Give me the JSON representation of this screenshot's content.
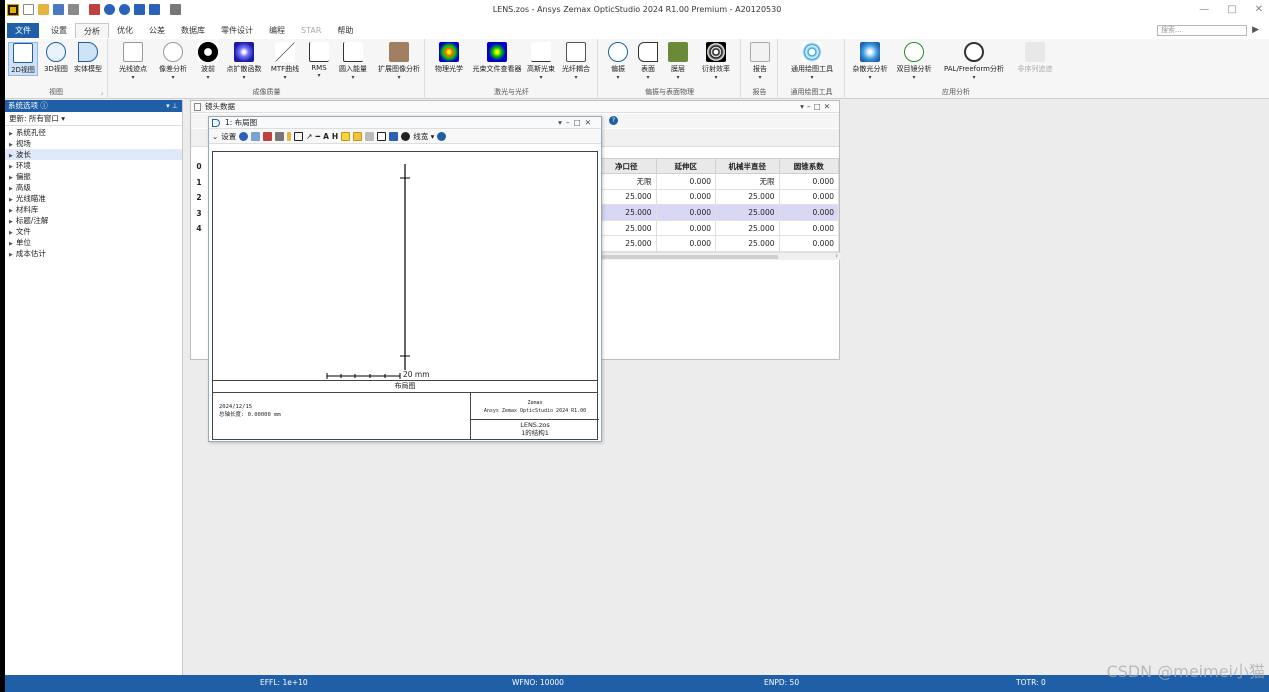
{
  "window": {
    "title": "LENS.zos - Ansys Zemax OpticStudio 2024 R1.00   Premium - A20120530",
    "controls": [
      "—",
      "□",
      "✕"
    ]
  },
  "ribbon_tabs": [
    {
      "label": "文件"
    },
    {
      "label": "设置"
    },
    {
      "label": "分析"
    },
    {
      "label": "优化"
    },
    {
      "label": "公差"
    },
    {
      "label": "数据库"
    },
    {
      "label": "零件设计"
    },
    {
      "label": "编程"
    },
    {
      "label": "STAR"
    },
    {
      "label": "帮助"
    }
  ],
  "search": {
    "placeholder": "搜索..."
  },
  "ribbon": {
    "view_buttons": [
      "2D视图",
      "3D视图",
      "实体模型"
    ],
    "view_group": "视图",
    "image_buttons": [
      "光线迹点",
      "像差分析",
      "波前",
      "点扩散函数",
      "MTF曲线",
      "RMS",
      "圆入能量",
      "扩展图像分析"
    ],
    "image_group": "成像质量",
    "laser_buttons": [
      "物理光学",
      "光束文件查看器",
      "高斯光束",
      "光纤耦合"
    ],
    "laser_group": "激光与光纤",
    "pol_buttons": [
      "偏振",
      "表面",
      "膜层",
      "衍射效率"
    ],
    "pol_group": "偏振与表面物理",
    "report_buttons": [
      "报告"
    ],
    "report_group": "报告",
    "plot_buttons": [
      "通用绘图工具"
    ],
    "plot_group": "通用绘图工具",
    "app_buttons": [
      "杂散光分析",
      "双目镜分析",
      "PAL/Freeform分析",
      "非序列追迹"
    ],
    "app_group": "应用分析"
  },
  "left_panel": {
    "title": "系统选项",
    "update": "更新: 所有窗口",
    "items": [
      "系统孔径",
      "视场",
      "波长",
      "环境",
      "偏振",
      "高级",
      "光线瞄准",
      "材料库",
      "标题/注解",
      "文件",
      "单位",
      "成本估计"
    ]
  },
  "lens_data": {
    "title": "镜头数据",
    "row_numbers": [
      "0",
      "1",
      "2",
      "3",
      "4"
    ],
    "columns": [
      "净口径",
      "延伸区",
      "机械半直径",
      "圆锥系数"
    ],
    "rows": [
      [
        "无限",
        "0.000",
        "无限",
        "0.000"
      ],
      [
        "25.000",
        "0.000",
        "25.000",
        "0.000"
      ],
      [
        "25.000",
        "0.000",
        "25.000",
        "0.000"
      ],
      [
        "25.000",
        "0.000",
        "25.000",
        "0.000"
      ],
      [
        "25.000",
        "0.000",
        "25.000",
        "0.000"
      ]
    ]
  },
  "layout_window": {
    "title": "1: 布局图",
    "settings": "设置",
    "line_width": "线宽",
    "scale_bar": "20 mm",
    "caption": "布局图",
    "date": "2024/12/15",
    "total_length": "总轴长度:    0.00000 mm",
    "brand": "Zemax",
    "product": "Ansys Zemax OpticStudio 2024 R1.00",
    "file": "LENS.zos",
    "config": "1的结构1"
  },
  "status_bar": {
    "effl": "EFFL: 1e+10",
    "wfno": "WFNO: 10000",
    "enpd": "ENPD: 50",
    "totr": "TOTR: 0"
  },
  "watermark": "CSDN @meimei小猫",
  "colors": {
    "accent": "#1e5fa8",
    "selected_row": "#d8d8f4"
  }
}
